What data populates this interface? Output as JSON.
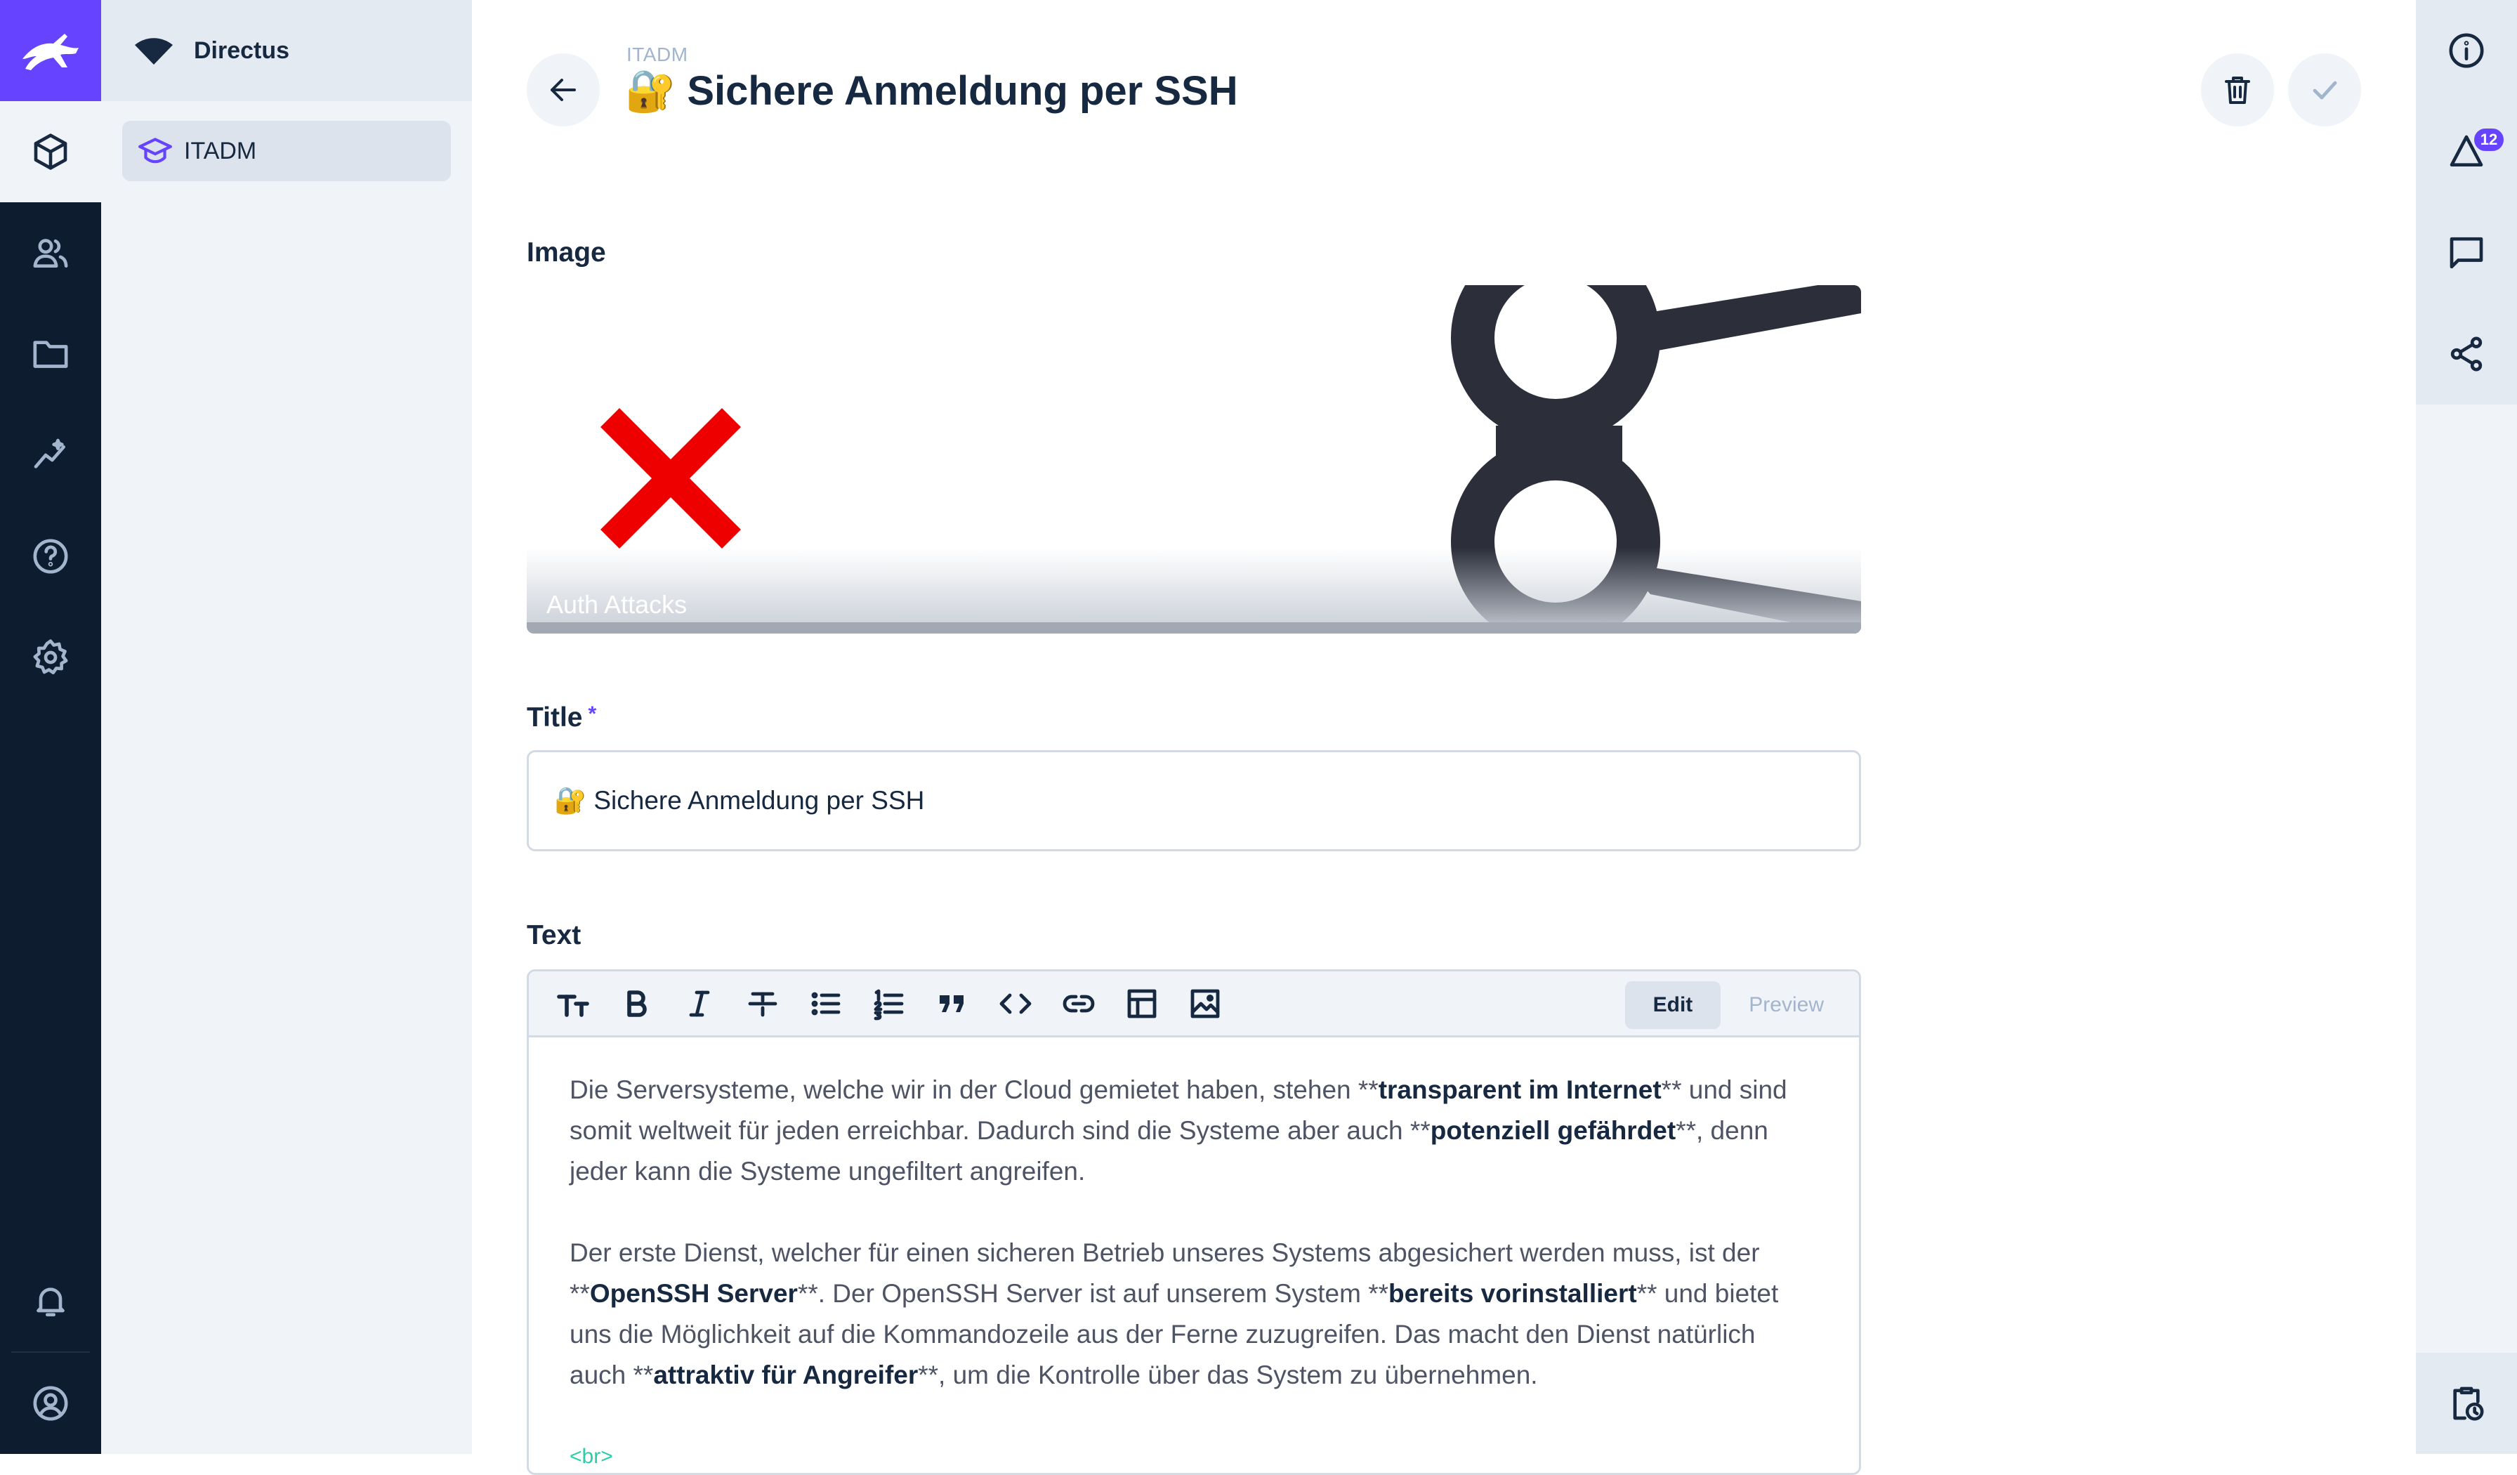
{
  "project": {
    "name": "Directus"
  },
  "navigation": {
    "items": [
      {
        "label": "ITADM",
        "icon": "school-icon"
      }
    ]
  },
  "modules": [
    "content-icon",
    "users-icon",
    "files-icon",
    "insights-icon",
    "help-icon",
    "settings-icon"
  ],
  "module_bottom": [
    "notifications-icon",
    "account-icon"
  ],
  "header": {
    "breadcrumb": "ITADM",
    "title": "🔐 Sichere Anmeldung per SSH"
  },
  "fields": {
    "image": {
      "label": "Image",
      "caption": "Auth Attacks"
    },
    "title": {
      "label": "Title",
      "required_mark": "*",
      "value": "🔐 Sichere Anmeldung per SSH"
    },
    "text": {
      "label": "Text",
      "tabs": {
        "edit": "Edit",
        "preview": "Preview"
      },
      "toolbar": [
        "heading-icon",
        "bold-icon",
        "italic-icon",
        "strikethrough-icon",
        "bullet-list-icon",
        "numbered-list-icon",
        "quote-icon",
        "code-icon",
        "link-icon",
        "table-icon",
        "image-icon"
      ],
      "paragraph1": {
        "t1": "Die Serversysteme, welche wir in der Cloud gemietet haben, stehen **",
        "b1": "transparent im Internet",
        "t2": "** und sind somit weltweit für jeden erreichbar. Dadurch sind die Systeme aber auch **",
        "b2": "potenziell gefährdet",
        "t3": "**, denn jeder kann die Systeme ungefiltert angreifen."
      },
      "paragraph2": {
        "t1": "Der erste Dienst, welcher für einen sicheren Betrieb unseres Systems abgesichert werden muss, ist der **",
        "b1": "OpenSSH Server",
        "t2": "**. Der OpenSSH Server ist auf unserem System **",
        "b2": "bereits vorinstalliert",
        "t3": "** und bietet uns die Möglichkeit auf die Kommandozeile aus der Ferne zuzugreifen. Das macht den Dienst natürlich auch **",
        "b3": "attraktiv für Angreifer",
        "t4": "**, um die Kontrolle über das System zu übernehmen."
      },
      "trailing_tag": "<br>"
    }
  },
  "sidebar": {
    "badge_count": "12",
    "items": [
      "info-icon",
      "revisions-icon",
      "comments-icon",
      "share-icon"
    ],
    "bottom": "activity-icon"
  },
  "colors": {
    "accent": "#6644ff",
    "module_bar": "#0e1c2f",
    "nav_bg": "#f0f4f9"
  }
}
